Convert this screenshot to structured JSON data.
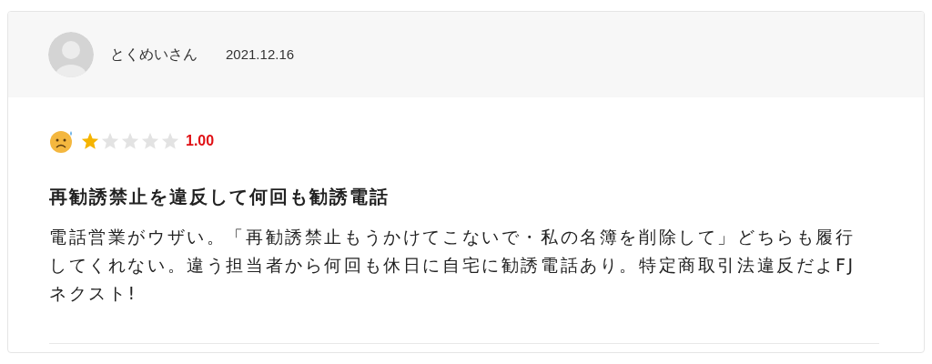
{
  "review": {
    "author": "とくめいさん",
    "date": "2021.12.16",
    "stars": 1,
    "score": "1.00",
    "title": "再勧誘禁止を違反して何回も勧誘電話",
    "body": "電話営業がウザい。「再勧誘禁止もうかけてこないで・私の名簿を削除して」どちらも履行してくれない。違う担当者から何回も休日に自宅に勧誘電話あり。特定商取引法違反だよFJネクスト!"
  }
}
